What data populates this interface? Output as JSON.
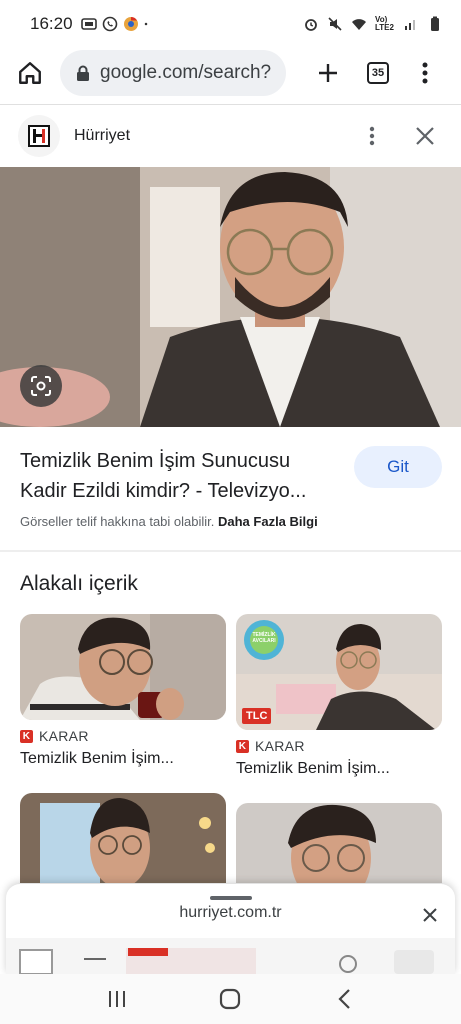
{
  "status_bar": {
    "time": "16:20",
    "network_label": "Vo) LTE2"
  },
  "browser": {
    "url": "google.com/search?",
    "tab_count": "35"
  },
  "source": {
    "name": "Hürriyet"
  },
  "result": {
    "title": "Temizlik Benim İşim Sunucusu Kadir Ezildi kimdir? - Televizyo...",
    "action_label": "Git",
    "copyright_notice": "Görseller telif hakkına tabi olabilir.",
    "more_info_label": "Daha Fazla Bilgi"
  },
  "related": {
    "heading": "Alakalı içerik",
    "cards": [
      {
        "source": "KARAR",
        "title": "Temizlik Benim İşim..."
      },
      {
        "source": "KARAR",
        "title": "Temizlik Benim İşim..."
      }
    ],
    "badge_text": "TLC",
    "badge_top": "TEMİZLİK AVCILARI"
  },
  "sheet": {
    "url": "hurriyet.com.tr"
  },
  "colors": {
    "accent_blue": "#1a57c9",
    "button_bg": "#e8f0fe",
    "karar_red": "#d93025"
  }
}
